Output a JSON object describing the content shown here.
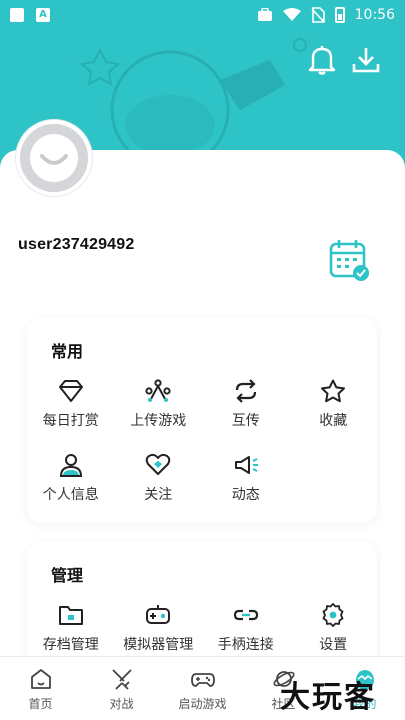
{
  "status_bar": {
    "time": "10:56",
    "left_icons": [
      "image-icon",
      "ai-icon"
    ],
    "right_icons": [
      "briefcase-icon",
      "wifi-icon",
      "no-sim-icon",
      "battery-icon"
    ]
  },
  "header": {
    "bell_icon": "bell-icon",
    "download_icon": "download-icon",
    "accent": "#2ec3c6"
  },
  "profile": {
    "username": "user237429492",
    "calendar_icon": "calendar-check-icon"
  },
  "common": {
    "title": "常用",
    "items": [
      {
        "label": "每日打赏",
        "icon": "diamond-icon"
      },
      {
        "label": "上传游戏",
        "icon": "upload-network-icon"
      },
      {
        "label": "互传",
        "icon": "transfer-icon"
      },
      {
        "label": "收藏",
        "icon": "star-icon"
      },
      {
        "label": "个人信息",
        "icon": "person-icon"
      },
      {
        "label": "关注",
        "icon": "heart-icon"
      },
      {
        "label": "动态",
        "icon": "megaphone-icon"
      }
    ]
  },
  "manage": {
    "title": "管理",
    "items": [
      {
        "label": "存档管理",
        "icon": "folder-icon"
      },
      {
        "label": "模拟器管理",
        "icon": "gamepad-icon"
      },
      {
        "label": "手柄连接",
        "icon": "link-icon"
      },
      {
        "label": "设置",
        "icon": "gear-icon"
      }
    ]
  },
  "tabbar": {
    "tabs": [
      {
        "label": "首页",
        "icon": "home-icon"
      },
      {
        "label": "对战",
        "icon": "swords-icon"
      },
      {
        "label": "启动游戏",
        "icon": "controller-icon"
      },
      {
        "label": "社区",
        "icon": "planet-icon"
      },
      {
        "label": "我的",
        "icon": "egg-icon"
      }
    ],
    "active_index": 4
  },
  "watermark": "大玩客"
}
